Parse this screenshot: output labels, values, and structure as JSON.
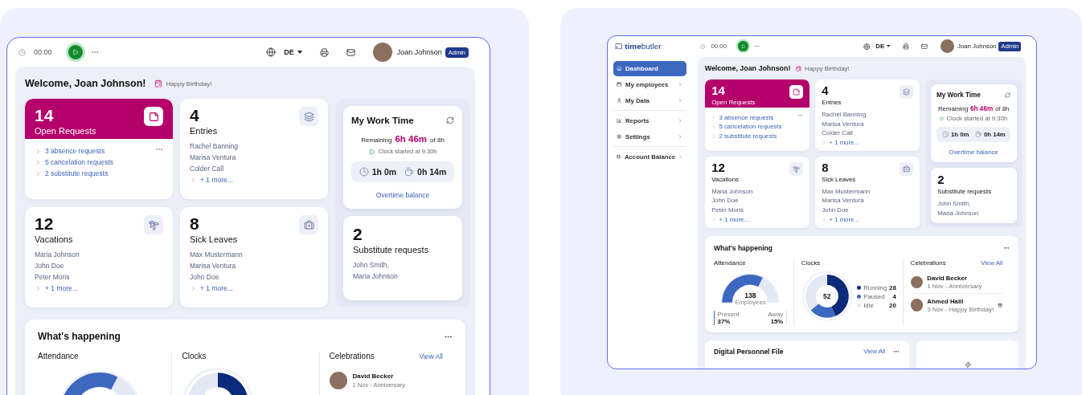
{
  "left_view": {
    "topbar": {
      "time": "00:00",
      "language": "DE",
      "user": "Joan Johnson",
      "role": "Admin"
    },
    "welcome": "Welcome, Joan Johnson!",
    "birthday_note": "Happy Birthday!",
    "cards": [
      {
        "kind": "highlight",
        "count": "14",
        "label": "Open Requests",
        "links": [
          "3 absence requests",
          "5 cancelation requests",
          "2 substitute requests"
        ]
      },
      {
        "kind": "list",
        "count": "4",
        "label": "Entries",
        "names": [
          "Rachel Banning",
          "Marisa Ventura",
          "Colder Call"
        ],
        "more": "+ 1 more..."
      },
      {
        "kind": "list",
        "count": "12",
        "label": "Vacations",
        "names": [
          "Maria Johnson",
          "John Doe",
          "Peter Moris"
        ],
        "more": "+ 1 more..."
      },
      {
        "kind": "list",
        "count": "8",
        "label": "Sick Leaves",
        "names": [
          "Max Mustermann",
          "Marisa Ventura",
          "John Doe"
        ],
        "more": "+ 1 more..."
      }
    ],
    "work_time": {
      "title": "My Work Time",
      "remaining_label": "Remaining",
      "remaining": "6h 46m",
      "of": "of 8h",
      "clock_note": "Clock started at 9:30h",
      "worked": "1h 0m",
      "break": "0h 14m",
      "link": "Overtime balance"
    },
    "substitute": {
      "count": "2",
      "label": "Substitute requests",
      "names": [
        "John Smith,",
        "Maria Johnson"
      ]
    },
    "whats_happening": {
      "title": "What's happening",
      "attendance": {
        "title": "Attendance"
      },
      "clocks": {
        "title": "Clocks"
      },
      "celebrations": {
        "title": "Celebrations",
        "view_all": "View All",
        "people": [
          {
            "name": "David Becker",
            "note": "1 Nov - Anniversary",
            "birthday": false
          }
        ]
      }
    }
  },
  "right_view": {
    "logo": "**time**butler",
    "sidebar": {
      "groups": [
        [
          {
            "label": "Dashboard",
            "selected": true,
            "submenu": false
          },
          {
            "label": "My employees",
            "selected": false,
            "submenu": true
          },
          {
            "label": "My Data",
            "selected": false,
            "submenu": true
          }
        ],
        [
          {
            "label": "Reports",
            "selected": false,
            "submenu": true
          },
          {
            "label": "Settings",
            "selected": false,
            "submenu": true
          }
        ],
        [
          {
            "label": "Account Balance",
            "selected": false,
            "submenu": true
          }
        ]
      ]
    },
    "topbar": {
      "time": "00:00",
      "language": "DE",
      "user": "Joan Johnson",
      "role": "Admin"
    },
    "welcome": "Welcome, Joan Johnson!",
    "birthday_note": "Happy Birthday!",
    "cards": [
      {
        "kind": "highlight",
        "count": "14",
        "label": "Open Requests",
        "links": [
          "3 absence requests",
          "5 cancelation requests",
          "2 substitute requests"
        ]
      },
      {
        "kind": "list",
        "count": "4",
        "label": "Entries",
        "names": [
          "Rachel Banning",
          "Marisa Ventura",
          "Colder Call"
        ],
        "more": "+ 1 more..."
      },
      {
        "kind": "list",
        "count": "12",
        "label": "Vacations",
        "names": [
          "Maria Johnson",
          "John Doe",
          "Peter Moris"
        ],
        "more": "+ 1 more..."
      },
      {
        "kind": "list",
        "count": "8",
        "label": "Sick Leaves",
        "names": [
          "Max Mustermann",
          "Marisa Ventura",
          "John Doe"
        ],
        "more": "+ 1 more..."
      }
    ],
    "work_time": {
      "title": "My Work Time",
      "remaining_label": "Remaining",
      "remaining": "6h 46m",
      "of": "of 8h",
      "clock_note": "Clock started at 9:30h",
      "worked": "1h 0m",
      "break": "0h 14m",
      "link": "Overtime balance"
    },
    "substitute": {
      "count": "2",
      "label": "Substitute requests",
      "names": [
        "John Smith,",
        "Maria Johnson"
      ]
    },
    "whats_happening": {
      "title": "What's happening",
      "attendance": {
        "title": "Attendance",
        "total": "138",
        "total_label": "Employees",
        "present_label": "Present",
        "present": "37%",
        "away_label": "Away",
        "away": "15%"
      },
      "clocks": {
        "title": "Clocks",
        "total": "52",
        "legend": [
          {
            "label": "Running",
            "value": "28",
            "color": "#0b2a7a"
          },
          {
            "label": "Paused",
            "value": "4",
            "color": "#3d68c0"
          },
          {
            "label": "Idle",
            "value": "20",
            "color": "#e3e8f5"
          }
        ]
      },
      "celebrations": {
        "title": "Celebrations",
        "view_all": "View All",
        "people": [
          {
            "name": "David Becker",
            "note": "1 Nov - Anniversary",
            "birthday": false
          },
          {
            "name": "Ahmed Halil",
            "note": "3 Nov - Happy Birthday!",
            "birthday": true
          }
        ]
      }
    },
    "digital_file": {
      "title": "Digital Personnel File",
      "view_all": "View All"
    }
  }
}
